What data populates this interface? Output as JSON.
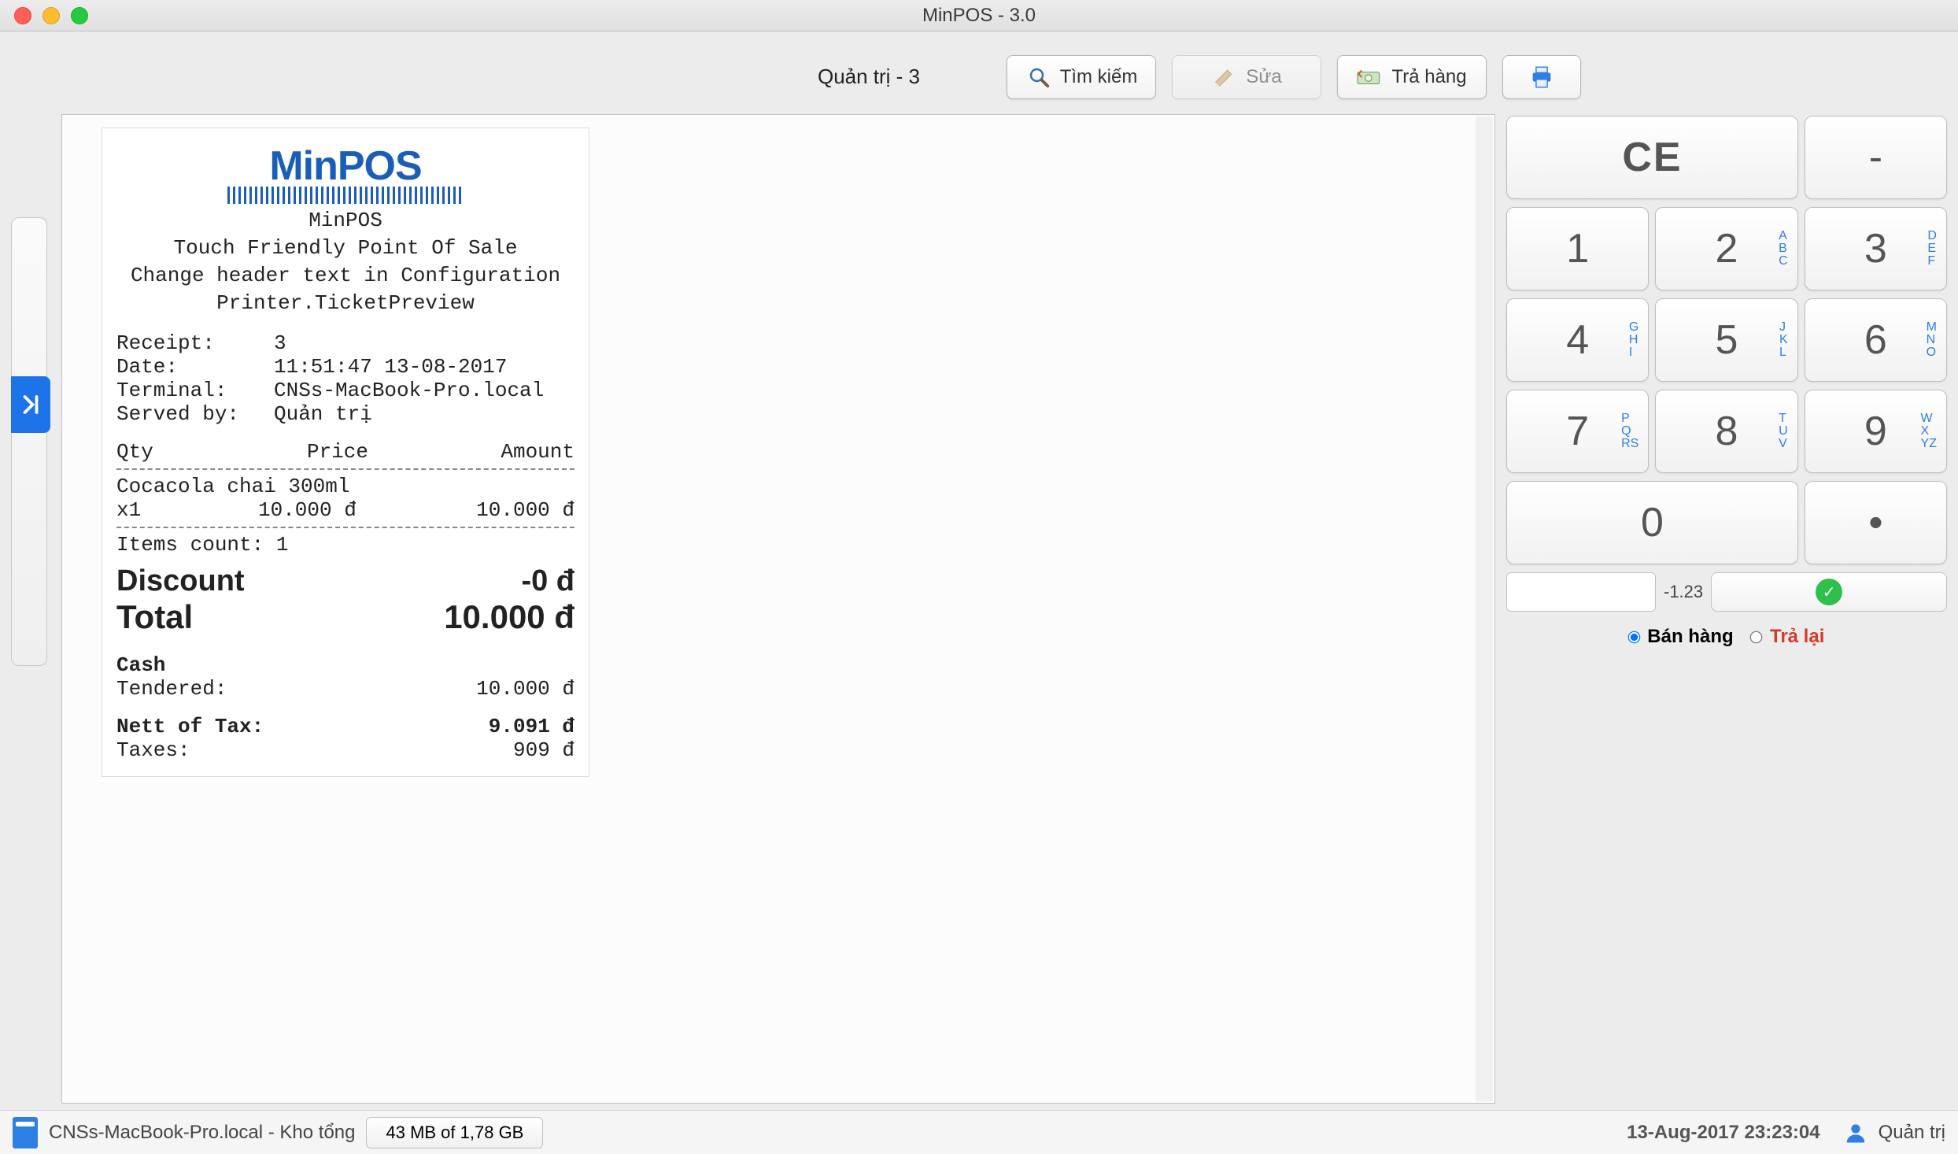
{
  "window": {
    "title": "MinPOS - 3.0"
  },
  "toolbar": {
    "admin_label": "Quản trị - 3",
    "search_label": "Tìm kiếm",
    "edit_label": "Sửa",
    "refund_label": "Trả hàng"
  },
  "receipt": {
    "logo_brand": "MinPOS",
    "header_line1": "MinPOS",
    "header_line2": "Touch Friendly Point Of Sale",
    "header_line3": "Change header text in Configuration",
    "header_line4": "Printer.TicketPreview",
    "receipt_label": "Receipt:",
    "receipt_value": "3",
    "date_label": "Date:",
    "date_value": "11:51:47 13-08-2017",
    "terminal_label": "Terminal:",
    "terminal_value": "CNSs-MacBook-Pro.local",
    "served_label": "Served by:",
    "served_value": "Quản trị",
    "col_qty": "Qty",
    "col_price": "Price",
    "col_amount": "Amount",
    "item_name": "Cocacola chai 300ml",
    "item_qty": "x1",
    "item_price": "10.000 đ",
    "item_amount": "10.000 đ",
    "items_count_label": "Items count: 1",
    "discount_label": "Discount",
    "discount_value": "-0 đ",
    "total_label": "Total",
    "total_value": "10.000 đ",
    "cash_label": "Cash",
    "tendered_label": "Tendered:",
    "tendered_value": "10.000 đ",
    "nett_label": "Nett of Tax:",
    "nett_value": "9.091 đ",
    "taxes_label": "Taxes:",
    "taxes_value": "909 đ"
  },
  "keypad": {
    "ce": "CE",
    "minus": "-",
    "k1": "1",
    "k2": "2",
    "k2s": "A\nB\nC",
    "k3": "3",
    "k3s": "D\nE\nF",
    "k4": "4",
    "k4s": "G\nH\nI",
    "k5": "5",
    "k5s": "J\nK\nL",
    "k6": "6",
    "k6s": "M\nN\nO",
    "k7": "7",
    "k7s": "P\nQ\nRS",
    "k8": "8",
    "k8s": "T\nU\nV",
    "k9": "9",
    "k9s": "W\nX\nYZ",
    "k0": "0",
    "dot": "•",
    "neg_caption": "-1.23",
    "radio_sell": "Bán hàng",
    "radio_refund": "Trả lại"
  },
  "status": {
    "host": "CNSs-MacBook-Pro.local - Kho tổng",
    "memory": "43 MB of 1,78 GB",
    "datetime": "13-Aug-2017 23:23:04",
    "user": "Quản trị"
  }
}
